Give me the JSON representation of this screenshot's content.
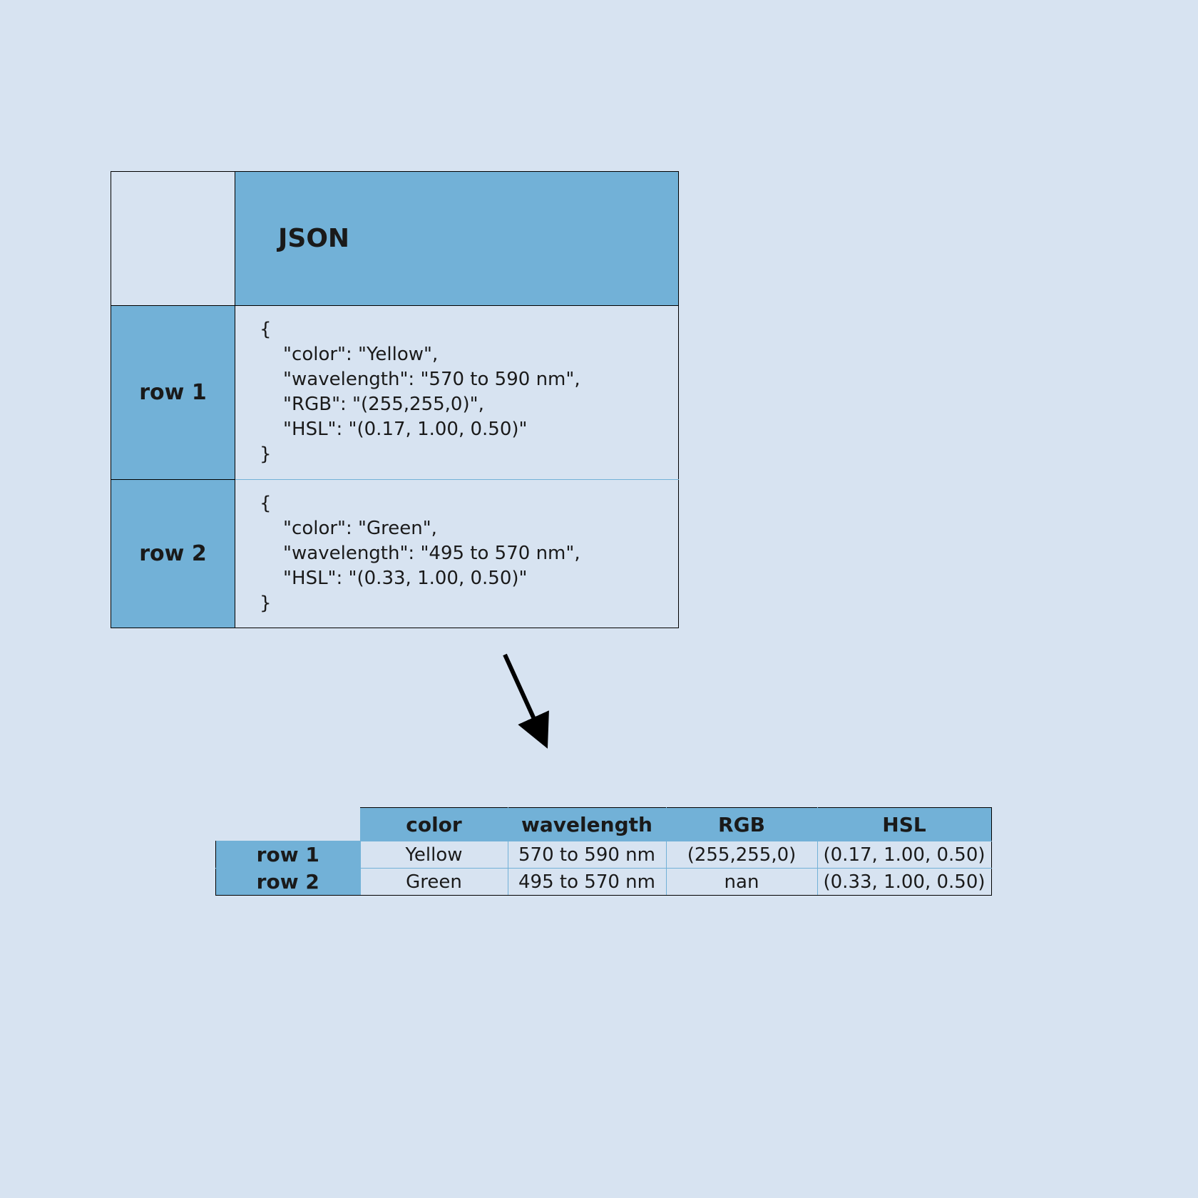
{
  "json_table": {
    "column_header": "JSON",
    "rows": [
      {
        "label": "row 1",
        "json_text": "{\n    \"color\": \"Yellow\",\n    \"wavelength\": \"570 to 590 nm\",\n    \"RGB\": \"(255,255,0)\",\n    \"HSL\": \"(0.17, 1.00, 0.50)\"\n}"
      },
      {
        "label": "row 2",
        "json_text": "{\n    \"color\": \"Green\",\n    \"wavelength\": \"495 to 570 nm\",\n    \"HSL\": \"(0.33, 1.00, 0.50)\"\n}"
      }
    ]
  },
  "data_table": {
    "columns": [
      "color",
      "wavelength",
      "RGB",
      "HSL"
    ],
    "rows": [
      {
        "label": "row 1",
        "cells": [
          "Yellow",
          "570 to 590 nm",
          "(255,255,0)",
          "(0.17, 1.00, 0.50)"
        ]
      },
      {
        "label": "row 2",
        "cells": [
          "Green",
          "495 to 570 nm",
          "nan",
          "(0.33, 1.00, 0.50)"
        ]
      }
    ]
  },
  "colors": {
    "header_fill": "#72b1d7",
    "background": "#d7e3f1"
  }
}
